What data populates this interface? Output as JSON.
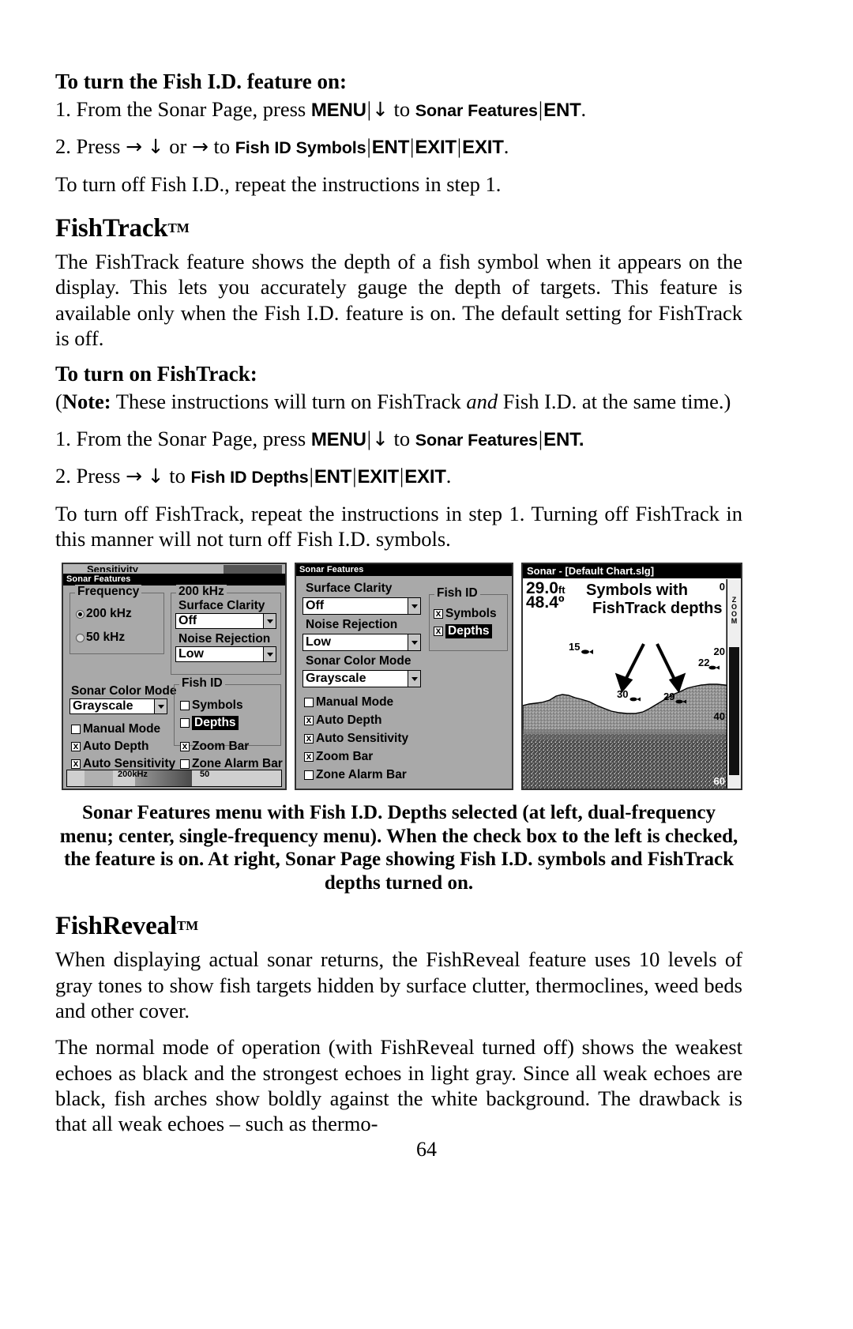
{
  "page": {
    "number": "64"
  },
  "sections": {
    "fishid_heading": "To turn the Fish I.D. feature on:",
    "fishid_step1": {
      "prefix": "1. From the Sonar Page, press ",
      "key1": "MENU",
      "mid1": " to ",
      "sc1": "Sonar Features",
      "key2": "ENT",
      "tail": "."
    },
    "fishid_step2": {
      "prefix": "2. Press ",
      "mid_or": " or ",
      "mid_to": " to ",
      "sc1": "Fish ID Symbols",
      "key1": "ENT",
      "key2": "EXIT",
      "key3": "EXIT",
      "tail": "."
    },
    "fishid_off": "To turn off Fish I.D., repeat the instructions in step 1.",
    "fishtrack_title": "FishTrack",
    "fishtrack_tm": "TM",
    "fishtrack_para": "The FishTrack feature shows the depth of a fish symbol when it appears on the display. This lets you accurately gauge the depth of targets. This feature is available only when the Fish I.D. feature is on. The default setting for FishTrack is off.",
    "fishtrack_howto_heading": "To turn on FishTrack:",
    "fishtrack_note": {
      "open": "(",
      "bold": "Note:",
      "text1": " These instructions will turn on FishTrack ",
      "ital": "and",
      "text2": " Fish I.D. at the same time.)"
    },
    "fishtrack_step1": {
      "prefix": "1. From the Sonar Page, press ",
      "key1": "MENU",
      "mid1": " to ",
      "sc1": "Sonar Features",
      "key2": "ENT."
    },
    "fishtrack_step2": {
      "prefix": "2. Press ",
      "mid_to": " to ",
      "sc1": "Fish ID Depths",
      "key1": "ENT",
      "key2": "EXIT",
      "key3": "EXIT",
      "tail": "."
    },
    "fishtrack_off": "To turn off FishTrack, repeat the instructions in step 1. Turning off FishTrack in this manner will not turn off Fish I.D. symbols.",
    "figure_caption": "Sonar Features menu with Fish I.D. Depths selected (at left, dual-frequency menu; center, single-frequency menu). When the check box to the left is checked, the feature is on. At right, Sonar Page showing Fish I.D. symbols and FishTrack depths turned on.",
    "fishreveal_title": "FishReveal",
    "fishreveal_tm": "TM",
    "fishreveal_para1": "When displaying actual sonar returns, the FishReveal feature uses 10 levels of gray tones to show fish targets hidden by surface clutter, thermoclines, weed beds and other cover.",
    "fishreveal_para2": "The normal mode of operation (with FishReveal turned off) shows the weakest echoes as black and the strongest echoes in light gray. Since all weak echoes are black, fish arches show boldly against the white background. The drawback is that all weak echoes – such as thermo-"
  },
  "figure": {
    "left_panel": {
      "behind_title": "Sensitivity",
      "title": "Sonar Features",
      "frequency_group": "Frequency",
      "freq_options": [
        {
          "label": "200 kHz",
          "selected": true
        },
        {
          "label": "50 kHz",
          "selected": false
        }
      ],
      "khz_group": "200 kHz",
      "surface_clarity_label": "Surface Clarity",
      "surface_clarity_value": "Off",
      "noise_rejection_label": "Noise Rejection",
      "noise_rejection_value": "Low",
      "color_mode_label": "Sonar Color Mode",
      "color_mode_value": "Grayscale",
      "fish_id_group": "Fish ID",
      "fish_id_items": [
        {
          "label": "Symbols",
          "checked": false,
          "highlighted": false
        },
        {
          "label": "Depths",
          "checked": false,
          "highlighted": true
        }
      ],
      "checks": [
        {
          "label": "Manual Mode",
          "checked": false
        },
        {
          "label": "Auto Depth",
          "checked": true
        },
        {
          "label": "Auto Sensitivity",
          "checked": true
        },
        {
          "label": "Zoom Bar",
          "checked": true
        },
        {
          "label": "Zone Alarm Bar",
          "checked": false
        }
      ],
      "bottom_bar_left": "200kHz",
      "bottom_bar_right": "50"
    },
    "mid_panel": {
      "title": "Sonar Features",
      "surface_clarity_label": "Surface Clarity",
      "surface_clarity_value": "Off",
      "noise_rejection_label": "Noise Rejection",
      "noise_rejection_value": "Low",
      "color_mode_label": "Sonar Color Mode",
      "color_mode_value": "Grayscale",
      "fish_id_group": "Fish ID",
      "fish_id_items": [
        {
          "label": "Symbols",
          "checked": true,
          "highlighted": false
        },
        {
          "label": "Depths",
          "checked": true,
          "highlighted": true
        }
      ],
      "checks": [
        {
          "label": "Manual Mode",
          "checked": false
        },
        {
          "label": "Auto Depth",
          "checked": true
        },
        {
          "label": "Auto Sensitivity",
          "checked": true
        },
        {
          "label": "Zoom Bar",
          "checked": true
        },
        {
          "label": "Zone Alarm Bar",
          "checked": false
        }
      ]
    },
    "right_panel": {
      "title": "Sonar - [Default Chart.slg]",
      "depth_value": "29.0",
      "depth_unit": "ft",
      "temperature": "48.4º",
      "annotation_line1": "Symbols with",
      "annotation_line2": "FishTrack depths",
      "fish_labels": [
        "15",
        "22",
        "30",
        "29"
      ],
      "scale_labels": [
        "0",
        "20",
        "40",
        "60"
      ],
      "zoom_bar_vertical": "ZOOM"
    }
  }
}
